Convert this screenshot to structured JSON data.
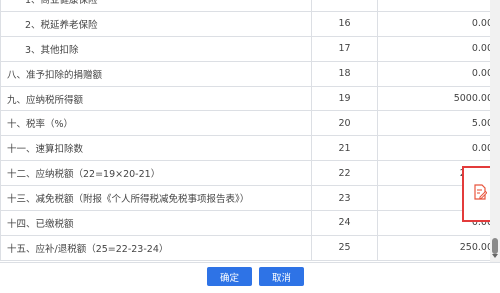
{
  "rows": [
    {
      "name": "2、税延养老保险",
      "line": "16",
      "amount": "0.00"
    },
    {
      "name": "3、其他扣除",
      "line": "17",
      "amount": "0.00"
    },
    {
      "name": "八、准予扣除的捐赠额",
      "line": "18",
      "amount": "0.00"
    },
    {
      "name": "九、应纳税所得额",
      "line": "19",
      "amount": "5000.00"
    },
    {
      "name": "十、税率（%）",
      "line": "20",
      "amount": "5.00"
    },
    {
      "name": "十一、速算扣除数",
      "line": "21",
      "amount": "0.00"
    },
    {
      "name": "十二、应纳税额（22=19×20-21）",
      "line": "22",
      "amount": "250.00"
    },
    {
      "name": "十三、减免税额（附报《个人所得税减免税事项报告表》）",
      "line": "23",
      "amount": "0.00"
    },
    {
      "name": "十四、已缴税额",
      "line": "24",
      "amount": "0.00"
    },
    {
      "name": "十五、应补/退税额（25=22-23-24）",
      "line": "25",
      "amount": "250.00"
    }
  ],
  "buttons": {
    "confirm": "确定",
    "cancel": "取消"
  },
  "icons": {
    "edit": "edit-document-icon"
  },
  "colors": {
    "primary": "#2e73e6",
    "highlight": "#e33b3b",
    "icon": "#e8553d"
  }
}
